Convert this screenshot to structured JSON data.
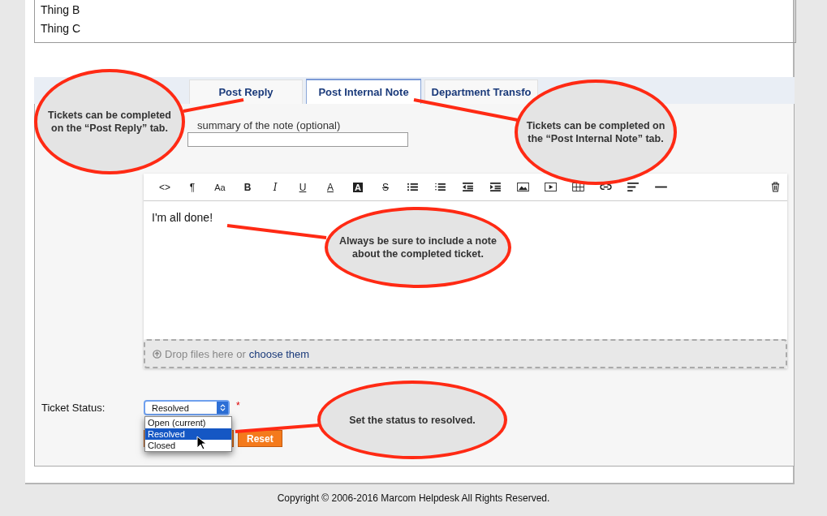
{
  "list_items": [
    "Thing B",
    "Thing C"
  ],
  "tabs": [
    {
      "label": "Post Reply",
      "selected": false
    },
    {
      "label": "Post Internal Note",
      "selected": true
    },
    {
      "label": "Department Transfo",
      "selected": false
    }
  ],
  "summary": {
    "label": "summary of the note (optional)"
  },
  "toolbar": [
    {
      "kind": "text",
      "label": "<>"
    },
    {
      "kind": "text",
      "label": "¶"
    },
    {
      "kind": "small",
      "label": "Aa"
    },
    {
      "kind": "bold",
      "label": "B"
    },
    {
      "kind": "italic",
      "label": "I"
    },
    {
      "kind": "underline",
      "label": "U"
    },
    {
      "kind": "color",
      "label": "A"
    },
    {
      "kind": "highlight",
      "label": "A"
    },
    {
      "kind": "strike",
      "label": "S"
    },
    {
      "kind": "ul"
    },
    {
      "kind": "ol"
    },
    {
      "kind": "outdent"
    },
    {
      "kind": "indent"
    },
    {
      "kind": "image"
    },
    {
      "kind": "video"
    },
    {
      "kind": "table"
    },
    {
      "kind": "link"
    },
    {
      "kind": "align"
    },
    {
      "kind": "hr"
    }
  ],
  "editor_text": "I'm all done!",
  "dropzone": {
    "text": "Drop files here or",
    "link": "choose them"
  },
  "status": {
    "label": "Ticket Status:",
    "value": "Resolved",
    "required": "*",
    "options": [
      {
        "label": "Open (current)",
        "selected": false
      },
      {
        "label": "Resolved",
        "selected": true
      },
      {
        "label": "Closed",
        "selected": false
      }
    ]
  },
  "buttons": {
    "reset": "Reset"
  },
  "callouts": [
    "Tickets can be completed on the “Post Reply” tab.",
    "Tickets can be completed on the “Post Internal Note” tab.",
    "Always be sure to include a note about the completed ticket.",
    "Set the status to resolved."
  ],
  "footer": "Copyright © 2006-2016 Marcom Helpdesk All Rights Reserved."
}
